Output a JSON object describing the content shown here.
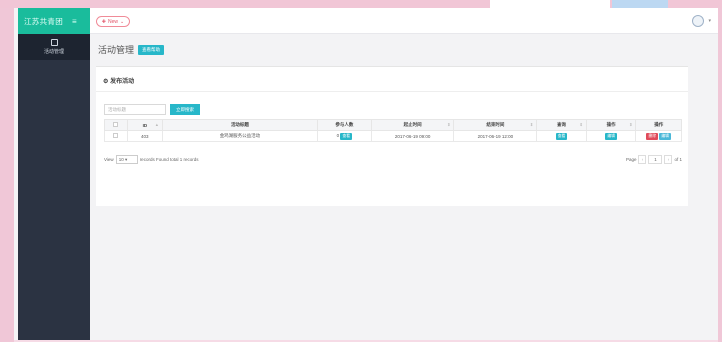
{
  "brand": {
    "name": "江苏共青团",
    "menu_icon": "hamburger-icon"
  },
  "sidebar": {
    "items": [
      {
        "label": "活动管理",
        "icon": "calendar-icon"
      }
    ]
  },
  "topbar": {
    "new_label": "New"
  },
  "page": {
    "title": "活动管理",
    "title_button": "查看帮助"
  },
  "panel": {
    "title": "发布活动",
    "search": {
      "placeholder": "活动标题",
      "button_label": "立即搜索"
    }
  },
  "table": {
    "columns": [
      "ID",
      "活动标题",
      "参与人数",
      "起止时间",
      "结束时间",
      "查询",
      "操作",
      "操作"
    ],
    "rows": [
      {
        "id": "403",
        "title": "金鸡湖服务公益活动",
        "participants": "0",
        "participants_btn": "查看",
        "start_time": "2017-06-19 09:00",
        "end_time": "2017-06-19 12:00",
        "view_btn": "查看",
        "edit_btn": "编辑",
        "delete_btn": "删除",
        "modify_btn": "编辑"
      }
    ]
  },
  "pager": {
    "view_prefix": "View",
    "per_page": "10",
    "records_text": "records Found total 1 records",
    "page_label": "Page",
    "current_page": "1",
    "of_text": "of 1"
  },
  "colors": {
    "brand": "#1abc9c",
    "accent": "#27b7c9",
    "danger": "#e04a5a",
    "sidebar": "#2b3342"
  }
}
